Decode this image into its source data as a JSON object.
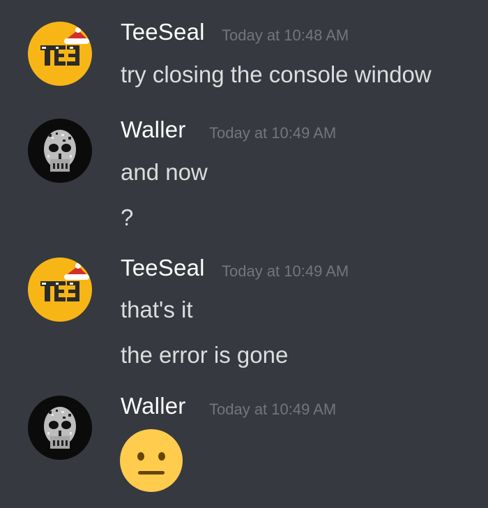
{
  "messages": [
    {
      "author": "TeeSeal",
      "timestamp": "Today at 10:48 AM",
      "avatar": "teeseal-logo-santa-hat",
      "lines": [
        "try closing the console window"
      ]
    },
    {
      "author": "Waller",
      "timestamp": "Today at 10:49 AM",
      "avatar": "pixel-skull-mask",
      "lines": [
        "and now",
        "?"
      ]
    },
    {
      "author": "TeeSeal",
      "timestamp": "Today at 10:49 AM",
      "avatar": "teeseal-logo-santa-hat",
      "lines": [
        "that's it",
        "the error is gone"
      ]
    },
    {
      "author": "Waller",
      "timestamp": "Today at 10:49 AM",
      "avatar": "pixel-skull-mask",
      "emoji": "neutral-face"
    }
  ],
  "colors": {
    "background": "#36393f",
    "username": "#ffffff",
    "timestamp": "#72767d",
    "message_text": "#dcddde",
    "teeseal_avatar": "#f8b616",
    "emoji_yellow": "#ffcc4d"
  }
}
